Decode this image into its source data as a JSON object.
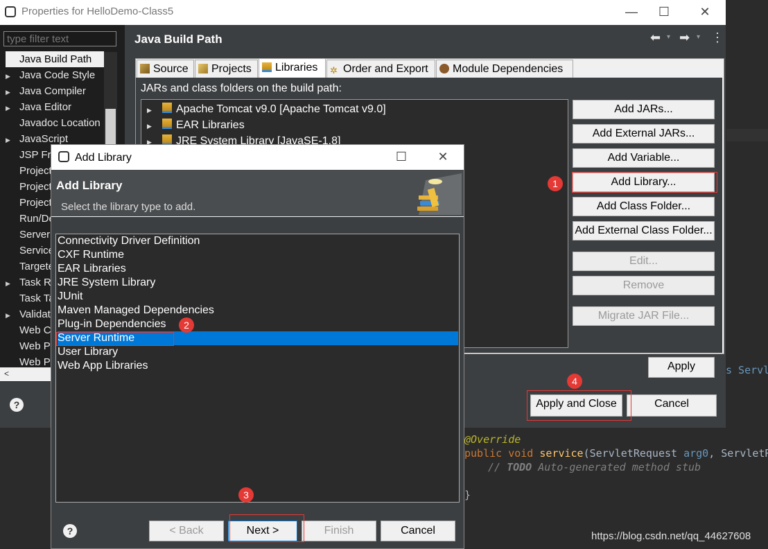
{
  "editor": {
    "code_line_a": "s Servl",
    "annotation": "@Override",
    "kw_public": "public",
    "kw_void": "void",
    "method": "service",
    "params_open": "(ServletRequest ",
    "arg0": "arg0",
    "params_rest": ", ServletR",
    "comment_prefix": "// ",
    "comment_todo": "TODO",
    "comment_rest": " Auto-generated method stub",
    "brace": "}"
  },
  "properties_window": {
    "title": "Properties for HelloDemo-Class5",
    "filter_placeholder": "type filter text",
    "tree_items": [
      {
        "label": "Java Build Path",
        "expandable": false,
        "selected": true
      },
      {
        "label": "Java Code Style",
        "expandable": true
      },
      {
        "label": "Java Compiler",
        "expandable": true
      },
      {
        "label": "Java Editor",
        "expandable": true
      },
      {
        "label": "Javadoc Location",
        "expandable": false
      },
      {
        "label": "JavaScript",
        "expandable": true
      },
      {
        "label": "JSP Fragment",
        "expandable": false
      },
      {
        "label": "Project Facets",
        "expandable": false
      },
      {
        "label": "Project References",
        "expandable": false
      },
      {
        "label": "Project Natures",
        "expandable": false
      },
      {
        "label": "Run/Debug Settings",
        "expandable": false
      },
      {
        "label": "Server",
        "expandable": false
      },
      {
        "label": "Service Policies",
        "expandable": false
      },
      {
        "label": "Targeted Runtimes",
        "expandable": false
      },
      {
        "label": "Task Repository",
        "expandable": true
      },
      {
        "label": "Task Tags",
        "expandable": false
      },
      {
        "label": "Validation",
        "expandable": true
      },
      {
        "label": "Web Content Settings",
        "expandable": false
      },
      {
        "label": "Web Page Editor",
        "expandable": false
      },
      {
        "label": "Web Project Settings",
        "expandable": false
      }
    ],
    "panel_title": "Java Build Path",
    "tabs": [
      "Source",
      "Projects",
      "Libraries",
      "Order and Export",
      "Module Dependencies"
    ],
    "active_tab": "Libraries",
    "jars_label": "JARs and class folders on the build path:",
    "jar_entries": [
      "Apache Tomcat v9.0 [Apache Tomcat v9.0]",
      "EAR Libraries",
      "JRE System Library [JavaSE-1.8]"
    ],
    "buttons": {
      "add_jars": "Add JARs...",
      "add_external_jars": "Add External JARs...",
      "add_variable": "Add Variable...",
      "add_library": "Add Library...",
      "add_class_folder": "Add Class Folder...",
      "add_external_class_folder": "Add External Class Folder...",
      "edit": "Edit...",
      "remove": "Remove",
      "migrate_jar": "Migrate JAR File...",
      "apply": "Apply",
      "apply_and_close": "Apply and Close",
      "cancel": "Cancel"
    },
    "help": "?"
  },
  "add_library_dialog": {
    "title": "Add Library",
    "header_title": "Add Library",
    "header_subtitle": "Select the library type to add.",
    "library_types": [
      "Connectivity Driver Definition",
      "CXF Runtime",
      "EAR Libraries",
      "JRE System Library",
      "JUnit",
      "Maven Managed Dependencies",
      "Plug-in Dependencies",
      "Server Runtime",
      "User Library",
      "Web App Libraries"
    ],
    "selected_type": "Server Runtime",
    "buttons": {
      "back": "< Back",
      "next": "Next >",
      "finish": "Finish",
      "cancel": "Cancel"
    },
    "help": "?"
  },
  "annotations": {
    "markers": [
      "1",
      "2",
      "3",
      "4"
    ],
    "marker_color": "#e53935"
  },
  "watermark": "https://blog.csdn.net/qq_44627608",
  "colors": {
    "selection": "#0078d7",
    "dark_bg": "#3c3f41"
  }
}
